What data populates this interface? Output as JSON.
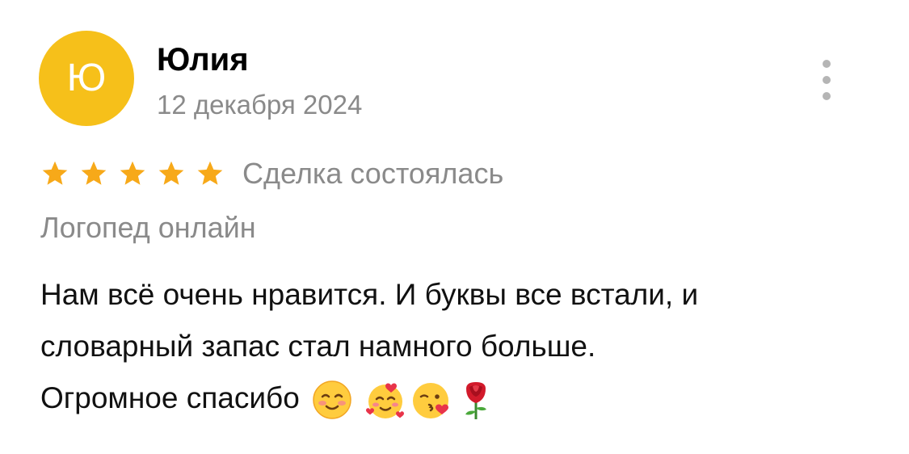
{
  "review": {
    "avatar_letter": "Ю",
    "author": "Юлия",
    "date": "12 декабря 2024",
    "rating": 5,
    "status": "Сделка состоялась",
    "service": "Логопед онлайн",
    "text_lines": [
      "Нам всё очень нравится. И буквы все встали, и",
      "словарный запас стал намного больше.",
      "Огромное спасибо"
    ],
    "emojis": [
      "smiling-face-icon",
      "smiling-face-with-hearts-icon",
      "face-blowing-kiss-icon",
      "rose-icon"
    ]
  },
  "colors": {
    "avatar_bg": "#f6c01a",
    "star": "#f7a919",
    "secondary_text": "#8a8a8a",
    "menu_dots": "#b5b5b5"
  },
  "icons": {
    "more": "more-vertical-icon",
    "star": "star-icon"
  }
}
